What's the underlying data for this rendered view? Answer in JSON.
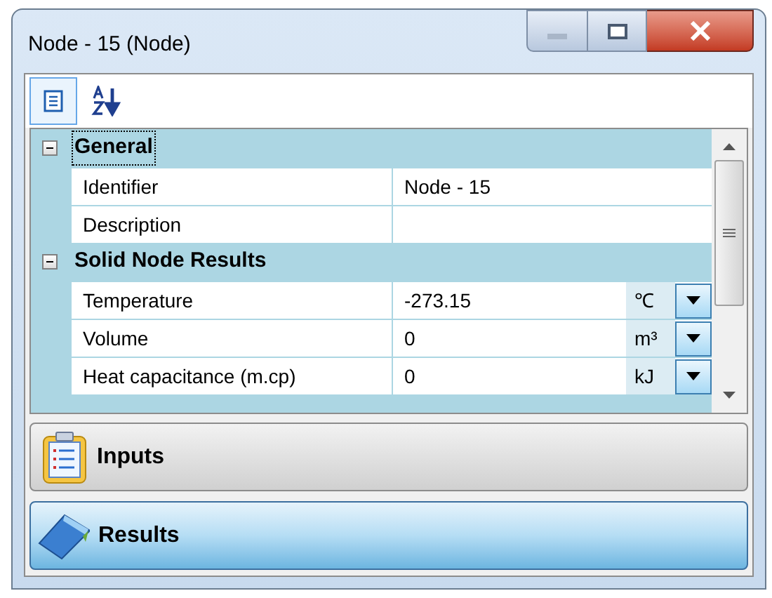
{
  "window": {
    "title": "Node - 15 (Node)"
  },
  "toolbar": [
    {
      "kind": "categorized",
      "selected": true
    },
    {
      "kind": "alphabetical",
      "selected": false
    }
  ],
  "grid": {
    "categories": [
      {
        "name": "General",
        "expanded": true,
        "focused": true,
        "rows": [
          {
            "name": "Identifier",
            "value": "Node - 15"
          },
          {
            "name": "Description"
          }
        ]
      },
      {
        "name": "Solid Node Results",
        "expanded": true,
        "focused": false,
        "rows": [
          {
            "name": "Temperature",
            "value": "-273.15",
            "unit": "℃"
          },
          {
            "name": "Volume",
            "value": "0",
            "unit": "m³"
          },
          {
            "name": "Heat capacitance (m.cp)",
            "value": "0",
            "unit": "kJ"
          }
        ]
      }
    ]
  },
  "panels": [
    {
      "kind": "inputs",
      "label": "Inputs",
      "selected": false
    },
    {
      "kind": "results",
      "label": "Results",
      "selected": true
    }
  ]
}
